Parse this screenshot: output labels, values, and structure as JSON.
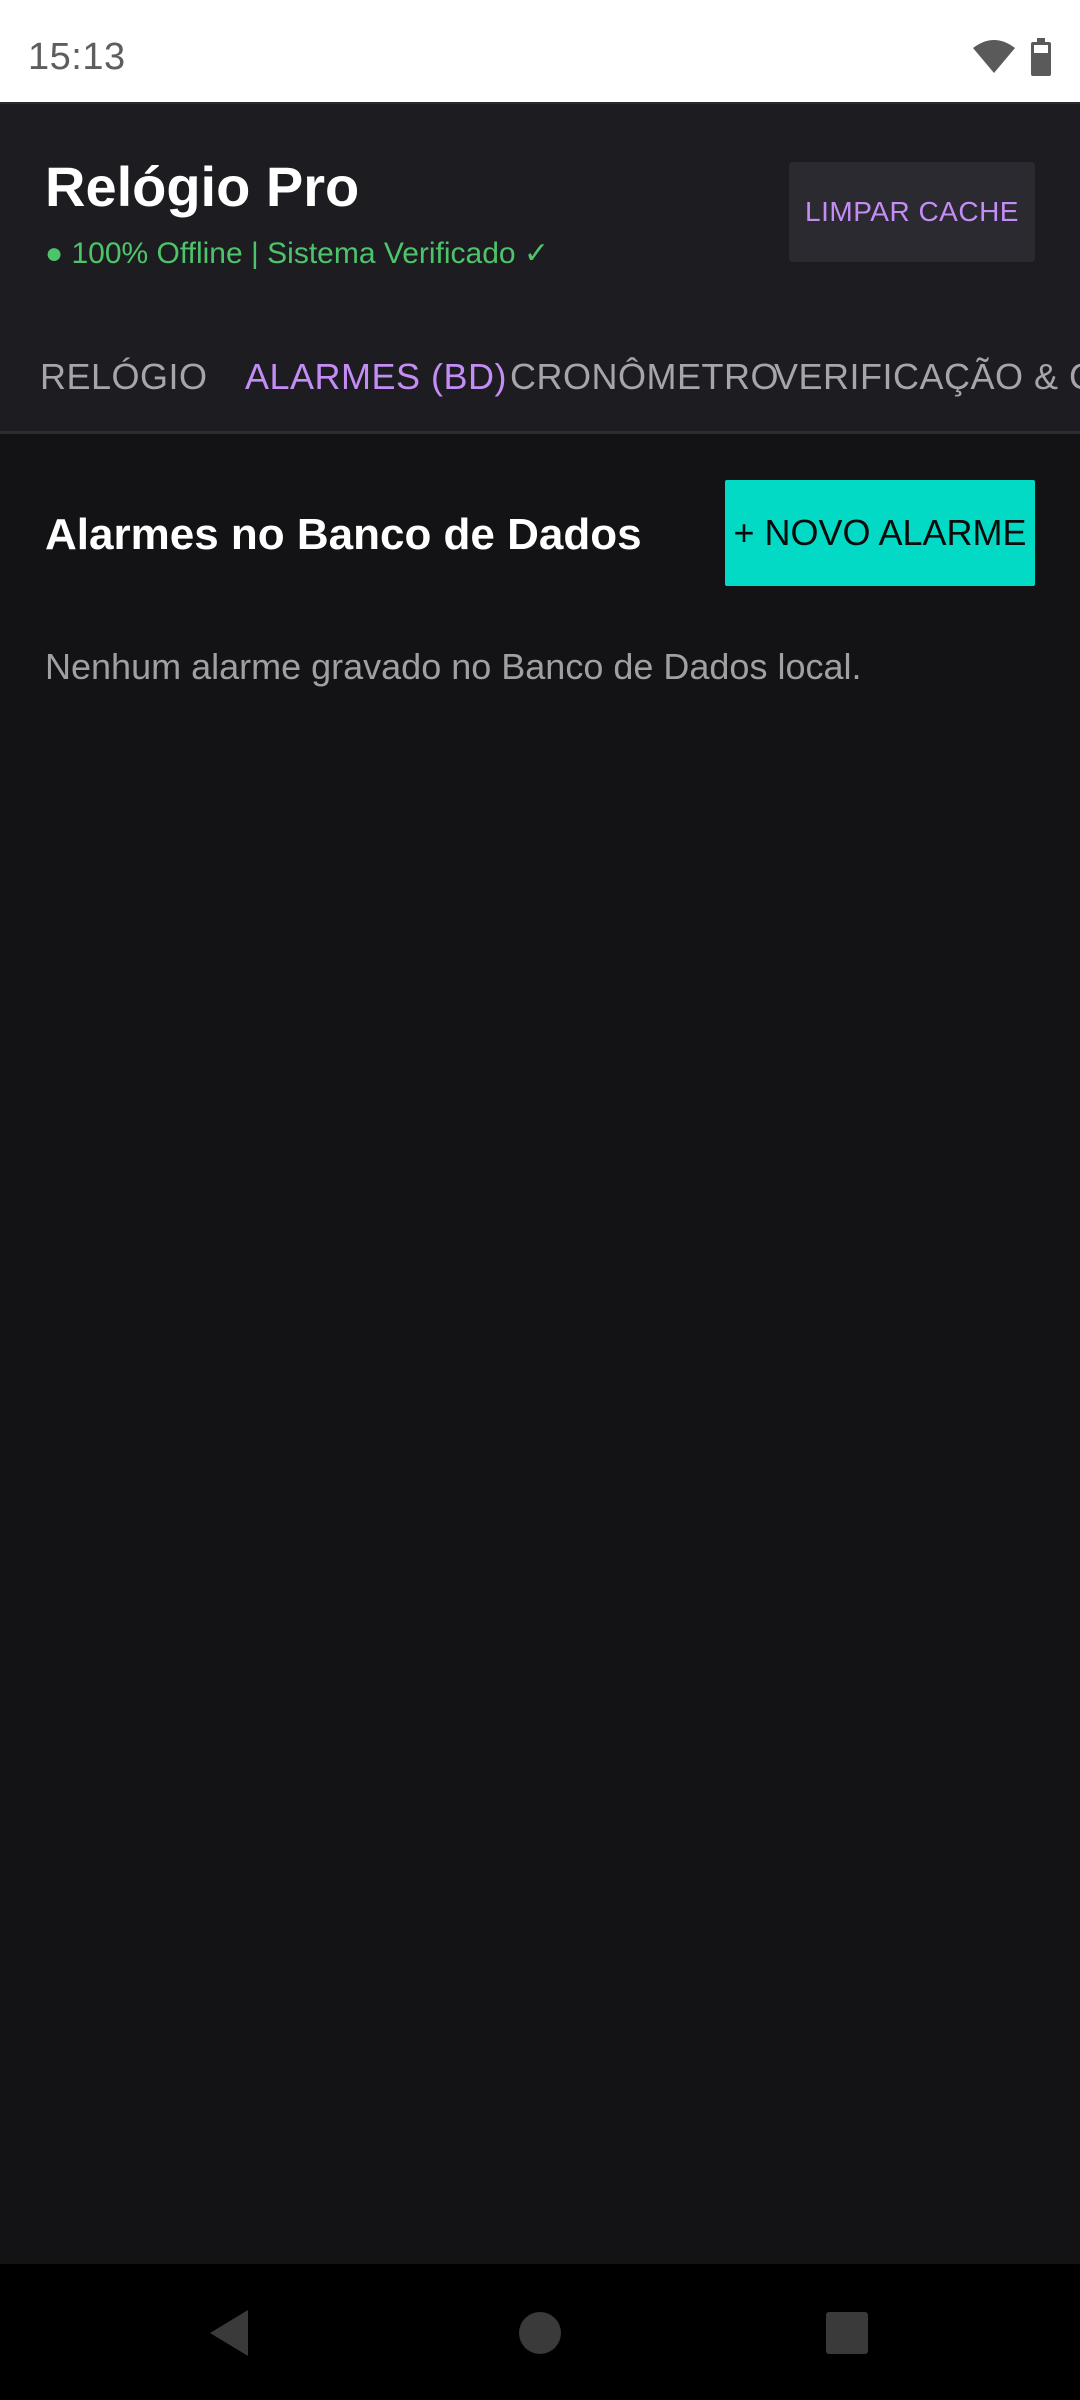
{
  "status_bar": {
    "time": "15:13",
    "icons": [
      "wifi-icon",
      "battery-icon"
    ]
  },
  "header": {
    "title": "Relógio Pro",
    "status": "● 100% Offline | Sistema Verificado ✓",
    "clear_cache_label": "LIMPAR CACHE"
  },
  "tabs": [
    {
      "label": "RELÓGIO",
      "active": false
    },
    {
      "label": "ALARMES (BD)",
      "active": true
    },
    {
      "label": "CRONÔMETRO",
      "active": false
    },
    {
      "label": "VERIFICAÇÃO & C",
      "active": false
    }
  ],
  "alarms": {
    "section_title": "Alarmes no Banco de Dados",
    "new_alarm_label": "+ NOVO ALARME",
    "empty_message": "Nenhum alarme gravado no Banco de Dados local."
  },
  "nav": {
    "icons": [
      "back-icon",
      "home-icon",
      "recents-icon"
    ]
  },
  "colors": {
    "accent": "#c48cf5",
    "primary_button": "#03dac6",
    "status_ok": "#4ec46a",
    "background": "#131315",
    "header_background": "#1c1c21"
  }
}
